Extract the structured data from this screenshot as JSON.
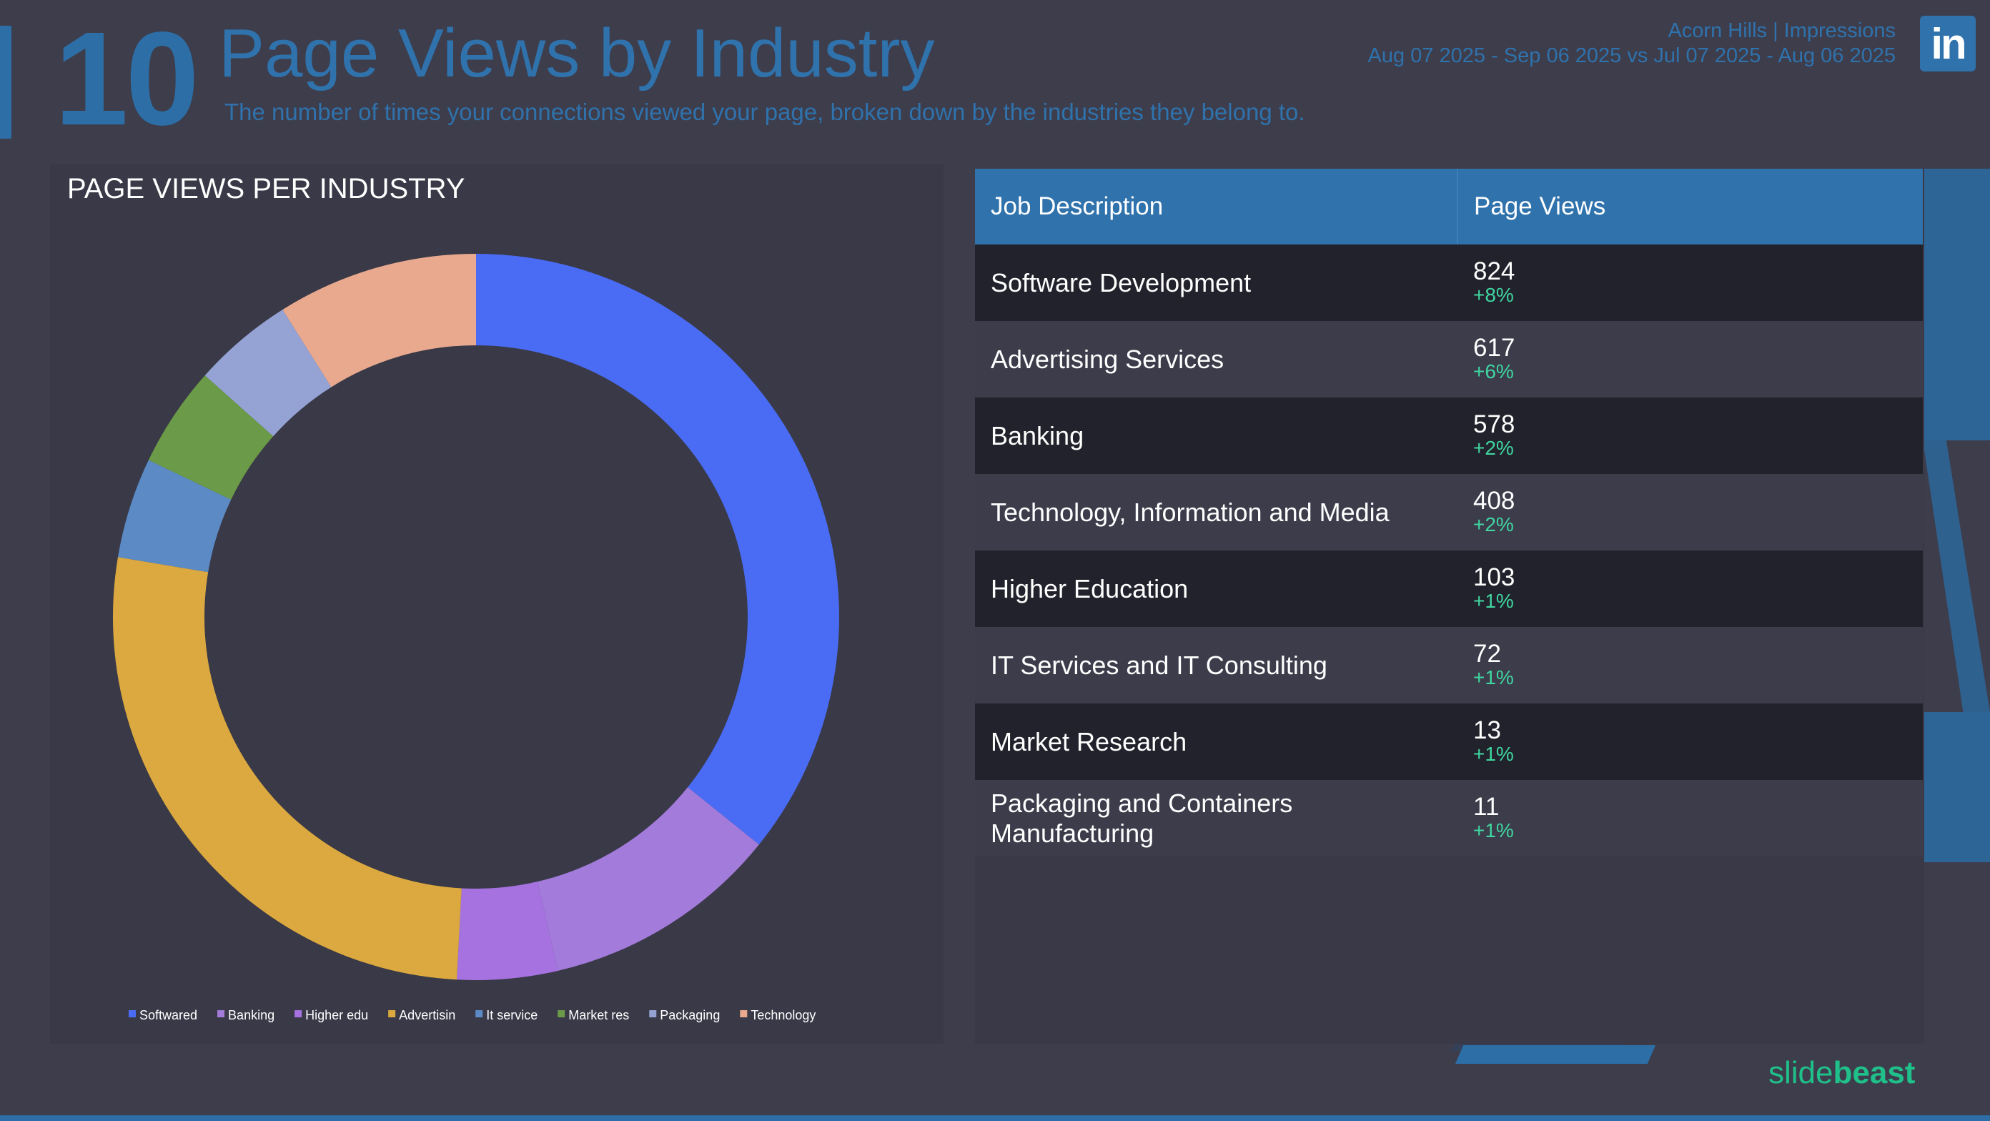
{
  "header": {
    "page_number": "10",
    "title": "Page Views by Industry",
    "subtitle": "The number of times your connections viewed your page, broken down by the industries they belong to.",
    "account_line": "Acorn Hills | Impressions",
    "date_range_line": "Aug 07 2025 - Sep 06 2025 vs Jul 07 2025 - Aug 06 2025",
    "linkedin_icon_text": "in",
    "linkedin_icon": "linkedin-icon"
  },
  "chart": {
    "panel_title": "PAGE VIEWS PER INDUSTRY"
  },
  "chart_data": {
    "type": "pie",
    "variant": "donut",
    "title": "PAGE VIEWS PER INDUSTRY",
    "start_angle_deg": 0,
    "direction": "clockwise",
    "slices": [
      {
        "label": "Softwared",
        "value": 824,
        "color": "#4a6cf4"
      },
      {
        "label": "Banking",
        "value": 244,
        "color": "#a37bdb"
      },
      {
        "label": "Higher edu",
        "value": 103,
        "color": "#a572e0"
      },
      {
        "label": "Advertisin",
        "value": 617,
        "color": "#dba93f"
      },
      {
        "label": "It service",
        "value": 103,
        "color": "#5b8ac4"
      },
      {
        "label": "Market res",
        "value": 103,
        "color": "#6b9a48"
      },
      {
        "label": "Packaging",
        "value": 103,
        "color": "#95a3d4"
      },
      {
        "label": "Technology",
        "value": 206,
        "color": "#e8a98e"
      }
    ],
    "legend_position": "bottom"
  },
  "table": {
    "headers": [
      "Job Description",
      "Page Views"
    ],
    "rows": [
      {
        "description": "Software Development",
        "views": "824",
        "change": "+8%"
      },
      {
        "description": "Advertising Services",
        "views": "617",
        "change": "+6%"
      },
      {
        "description": "Banking",
        "views": "578",
        "change": "+2%"
      },
      {
        "description": "Technology, Information and Media",
        "views": "408",
        "change": "+2%"
      },
      {
        "description": "Higher Education",
        "views": "103",
        "change": "+1%"
      },
      {
        "description": "IT Services and IT Consulting",
        "views": "72",
        "change": "+1%"
      },
      {
        "description": "Market Research",
        "views": "13",
        "change": "+1%"
      },
      {
        "description": "Packaging and Containers Manufacturing",
        "views": "11",
        "change": "+1%"
      }
    ],
    "change_color": "#3fd6a0"
  },
  "footer": {
    "brand_light": "slide",
    "brand_bold": "beast"
  },
  "colors": {
    "background": "#3d3d4c",
    "accent": "#2f72ac",
    "brand_green": "#1fc08a"
  }
}
